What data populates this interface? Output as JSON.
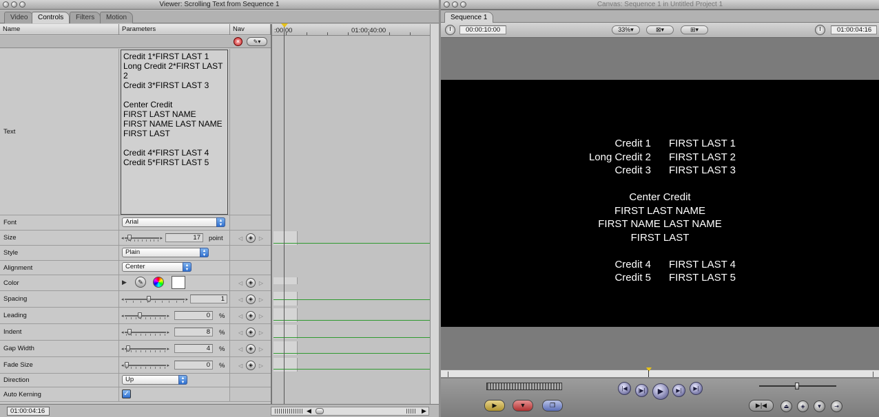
{
  "viewer": {
    "title": "Viewer: Scrolling Text from Sequence 1",
    "tabs": [
      {
        "label": "Video"
      },
      {
        "label": "Controls"
      },
      {
        "label": "Filters"
      },
      {
        "label": "Motion"
      }
    ],
    "columns": {
      "name": "Name",
      "parameters": "Parameters",
      "nav": "Nav"
    },
    "ruler": {
      "start": ":00:00",
      "mark": "01:00:40:00"
    },
    "text_param": {
      "label": "Text",
      "lines": [
        "Credit 1*FIRST LAST 1",
        "Long Credit 2*FIRST LAST",
        "2",
        "Credit 3*FIRST LAST 3",
        "",
        "Center Credit",
        "FIRST LAST NAME",
        "FIRST NAME LAST NAME",
        "FIRST LAST",
        "",
        "Credit 4*FIRST LAST 4",
        "Credit 5*FIRST LAST 5"
      ]
    },
    "params": {
      "font": {
        "label": "Font",
        "value": "Arial"
      },
      "size": {
        "label": "Size",
        "value": "17",
        "unit": "point",
        "slider_fraction": 0.1
      },
      "style": {
        "label": "Style",
        "value": "Plain"
      },
      "alignment": {
        "label": "Alignment",
        "value": "Center"
      },
      "color": {
        "label": "Color",
        "swatch": "#ffffff"
      },
      "spacing": {
        "label": "Spacing",
        "value": "1",
        "slider_fraction": 0.4
      },
      "leading": {
        "label": "Leading",
        "value": "0",
        "unit": "%",
        "slider_fraction": 0.35
      },
      "indent": {
        "label": "Indent",
        "value": "8",
        "unit": "%",
        "slider_fraction": 0.08
      },
      "gap_width": {
        "label": "Gap Width",
        "value": "4",
        "unit": "%",
        "slider_fraction": 0.04
      },
      "fade_size": {
        "label": "Fade Size",
        "value": "0",
        "unit": "%",
        "slider_fraction": 0.0
      },
      "direction": {
        "label": "Direction",
        "value": "Up"
      },
      "auto_kerning": {
        "label": "Auto Kerning",
        "checked": true
      }
    },
    "status_timecode": "01:00:04:16"
  },
  "canvas": {
    "title": "Canvas: Sequence 1 in Untitled Project 1",
    "tab": "Sequence 1",
    "duration_timecode": "00:00:10:00",
    "zoom": "33%",
    "current_timecode": "01:00:04:16",
    "credits": {
      "pairs_top": [
        {
          "role": "Credit 1",
          "name": "FIRST LAST 1"
        },
        {
          "role": "Long Credit 2",
          "name": "FIRST LAST 2"
        },
        {
          "role": "Credit 3",
          "name": "FIRST LAST 3"
        }
      ],
      "center": [
        "Center Credit",
        "FIRST LAST NAME",
        "FIRST NAME LAST NAME",
        "FIRST LAST"
      ],
      "pairs_bottom": [
        {
          "role": "Credit 4",
          "name": "FIRST LAST 4"
        },
        {
          "role": "Credit 5",
          "name": "FIRST LAST 5"
        }
      ]
    }
  }
}
